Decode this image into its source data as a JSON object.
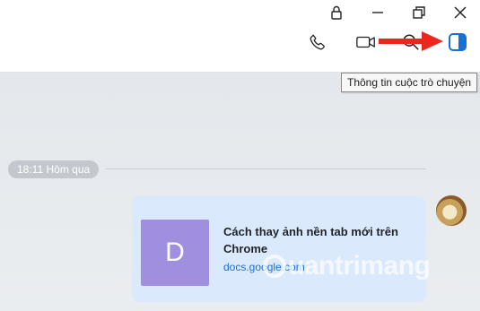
{
  "window_controls": {
    "lock": "lock-icon",
    "minimize": "minimize-icon",
    "restore": "restore-icon",
    "close": "close-icon"
  },
  "toolbar": {
    "call": "phone-icon",
    "video": "video-camera-icon",
    "search": "search-icon",
    "info_panel": "sidebar-panel-icon"
  },
  "tooltip": {
    "text": "Thông tin cuộc trò chuyện"
  },
  "chat": {
    "time_divider": "18:11 Hôm qua",
    "message": {
      "thumbnail_letter": "D",
      "title": "Cách thay ảnh nền tab mới trên Chrome",
      "domain": "docs.google.com"
    }
  },
  "watermark": {
    "text": "uantrimang"
  },
  "colors": {
    "accent": "#1a6fd6",
    "arrow": "#e8271f",
    "card_bg": "#dbe9fd",
    "thumbnail_bg": "#a08fde"
  }
}
